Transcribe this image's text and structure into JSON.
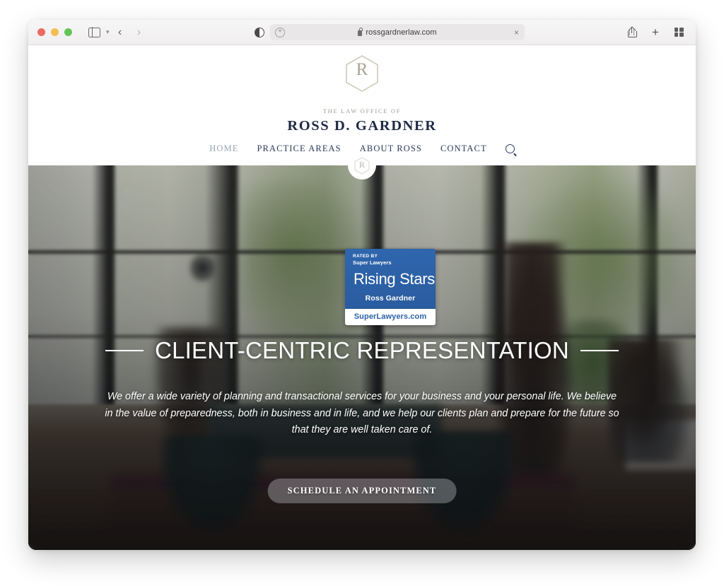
{
  "browser": {
    "traffic_lights": [
      "close",
      "minimize",
      "zoom"
    ],
    "sidebar_toggle_icon": "sidebar-icon",
    "back_label": "‹",
    "forward_label": "›",
    "shield_icon": "privacy-shield-icon",
    "url_add_icon": "plus-circle-icon",
    "url_lock_icon": "lock-icon",
    "url": "rossgardnerlaw.com",
    "url_close_label": "×",
    "share_icon": "share-icon",
    "new_tab_label": "+",
    "tab_overview_icon": "tab-overview-icon"
  },
  "site": {
    "logo_letter": "R",
    "eyebrow": "THE LAW OFFICE OF",
    "firm_name": "ROSS D. GARDNER",
    "nav": [
      {
        "label": "HOME",
        "active": true
      },
      {
        "label": "PRACTICE AREAS",
        "active": false
      },
      {
        "label": "ABOUT ROSS",
        "active": false
      },
      {
        "label": "CONTACT",
        "active": false
      }
    ],
    "search_icon": "search-icon",
    "seam_badge_letter": "R"
  },
  "badge": {
    "rated_by": "RATED BY",
    "brand": "Super Lawyers",
    "award": "Rising Stars",
    "attorney": "Ross Gardner",
    "site": "SuperLawyers.com",
    "color": "#2c62a8"
  },
  "hero": {
    "headline": "CLIENT-CENTRIC REPRESENTATION",
    "subhead": "We offer a wide variety of planning and transactional services for your business and your personal life. We believe in the value of preparedness, both in business and in life, and we help our clients plan and prepare for the future so that they are well taken care of.",
    "cta_label": "SCHEDULE AN APPOINTMENT"
  }
}
